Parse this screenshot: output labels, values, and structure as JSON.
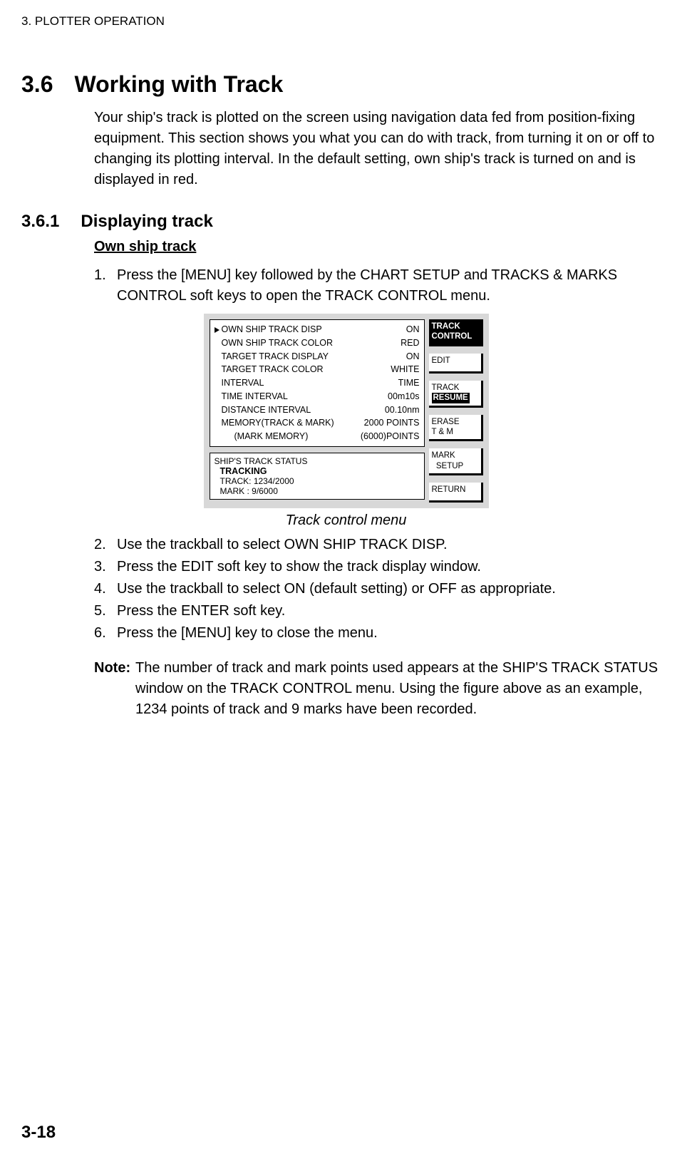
{
  "header": "3. PLOTTER OPERATION",
  "section": {
    "num": "3.6",
    "title": "Working with Track"
  },
  "intro": "Your ship's track is plotted on the screen using navigation data fed from position-fixing equipment. This section shows you what you can do with track, from turning it on or off to changing its plotting interval. In the default setting, own ship's track is turned on and is displayed in red.",
  "subsection": {
    "num": "3.6.1",
    "title": "Displaying track"
  },
  "subheading": "Own ship track",
  "step1": {
    "num": "1.",
    "text": "Press the [MENU] key followed by the CHART SETUP and TRACKS & MARKS CONTROL soft keys to open the TRACK CONTROL menu."
  },
  "menu": {
    "rows": [
      {
        "label": "OWN SHIP TRACK DISP",
        "value": "ON"
      },
      {
        "label": "OWN SHIP TRACK COLOR",
        "value": "RED"
      },
      {
        "label": "TARGET TRACK DISPLAY",
        "value": "ON"
      },
      {
        "label": "TARGET TRACK COLOR",
        "value": "WHITE"
      },
      {
        "label": "INTERVAL",
        "value": "TIME"
      },
      {
        "label": "TIME INTERVAL",
        "value": "00m10s"
      },
      {
        "label": "DISTANCE INTERVAL",
        "value": "00.10nm"
      },
      {
        "label": "MEMORY(TRACK & MARK)",
        "value": "2000 POINTS"
      },
      {
        "label": "(MARK MEMORY)",
        "value": "(6000)POINTS",
        "indent": true
      }
    ],
    "status": {
      "title": "SHIP'S TRACK STATUS",
      "bold": "TRACKING",
      "line1": "TRACK: 1234/2000",
      "line2": "MARK  :       9/6000"
    },
    "softkeys": {
      "header1": "TRACK",
      "header2": "CONTROL",
      "k1": "EDIT",
      "k2a": "TRACK",
      "k2b": "RESUME",
      "k3a": "ERASE",
      "k3b": "T & M",
      "k4a": "MARK",
      "k4b": "  SETUP",
      "k5": "RETURN"
    }
  },
  "caption": "Track control menu",
  "steps": [
    {
      "num": "2.",
      "text": "Use the trackball to select OWN SHIP TRACK DISP."
    },
    {
      "num": "3.",
      "text": "Press the EDIT soft key to show the track display window."
    },
    {
      "num": "4.",
      "text": "Use the trackball to select ON (default setting) or OFF as appropriate."
    },
    {
      "num": "5.",
      "text": "Press the ENTER soft key."
    },
    {
      "num": "6.",
      "text": "Press the [MENU] key to close the menu."
    }
  ],
  "note": {
    "label": "Note:",
    "text": "The number of track and mark points used appears at the SHIP'S TRACK STATUS window on the TRACK CONTROL menu. Using the figure above as an example, 1234 points of track and 9 marks have been recorded."
  },
  "pagenum": "3-18"
}
